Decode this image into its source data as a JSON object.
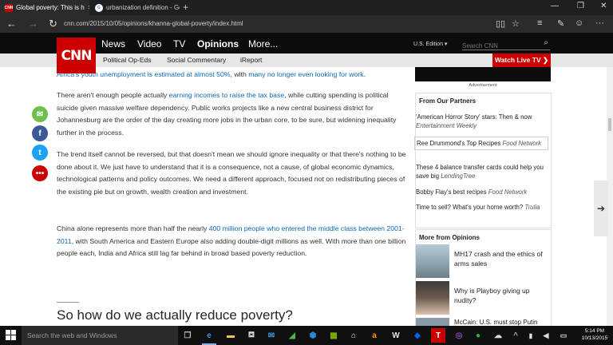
{
  "browser": {
    "tabs": [
      {
        "title": "Global poverty: This is h",
        "favicon": "CNN",
        "active": true
      },
      {
        "title": "urbanization definition - Goo",
        "favicon": "G",
        "active": false
      }
    ],
    "url": "cnn.com/2015/10/05/opinions/khanna-global-poverty/index.html"
  },
  "cnn": {
    "logo": "CNN",
    "nav": [
      "News",
      "Video",
      "TV",
      "Opinions",
      "More..."
    ],
    "edition": "U.S. Edition ▾",
    "search_placeholder": "Search CNN",
    "subnav": [
      "Political Op-Eds",
      "Social Commentary",
      "iReport"
    ],
    "live_tv": "Watch Live TV ❯"
  },
  "article": {
    "p0": {
      "link1": "Africa's youth unemployment is estimated at almost 50%",
      "mid": ", with ",
      "link2": "many no longer even looking for work",
      "end": "."
    },
    "p1": {
      "start": "There aren't enough people actually ",
      "link": "earning incomes to raise the tax base",
      "rest": ", while cutting spending is political suicide given massive welfare dependency. Public works projects like a new central business district for Johannesburg are the order of the day creating more jobs in the urban core, to be sure, but widening inequality further in the process."
    },
    "p2": "The trend itself cannot be reversed, but that doesn't mean we should ignore inequality or that there's nothing to be done about it. We just have to understand that it is a consequence, not a cause, of global economic dynamics, technological patterns and policy outcomes. We need a different approach, focused not on redistributing pieces of the existing pie but on growth, wealth creation and investment.",
    "p3": {
      "start": "China alone represents more than half the nearly ",
      "link": "400 million people who entered the middle class between 2001-2011",
      "rest": ", with South America and Eastern Europe also adding double-digit millions as well. With more than one billion people each, India and Africa still lag far behind in broad based poverty reduction."
    },
    "heading": "So how do we actually reduce poverty?"
  },
  "rail": {
    "ad_label": "Advertisement",
    "partners_title": "From Our Partners",
    "partners": [
      {
        "text": "'American Horror Story' stars: Then & now",
        "source": "Entertainment Weekly"
      },
      {
        "text": "Ree Drummond's Top Recipes",
        "source": "Food Network"
      },
      {
        "text": "These 4 balance transfer cards could help you save big",
        "source": "LendingTree"
      },
      {
        "text": "Bobby Flay's best recipes",
        "source": "Food Network"
      },
      {
        "text": "Time to sell? What's your home worth?",
        "source": "Trulia"
      }
    ],
    "opinions_title": "More from Opinions",
    "opinions": [
      {
        "text": "MH17 crash and the ethics of arms sales"
      },
      {
        "text": "Why is Playboy giving up nudity?"
      },
      {
        "text": "McCain: U.S. must stop Putin"
      }
    ]
  },
  "taskbar": {
    "search_placeholder": "Search the web and Windows",
    "time": "5:14 PM",
    "date": "10/13/2015"
  },
  "colors": {
    "cnn_red": "#cc0000",
    "link_blue": "#0c6ab3"
  }
}
